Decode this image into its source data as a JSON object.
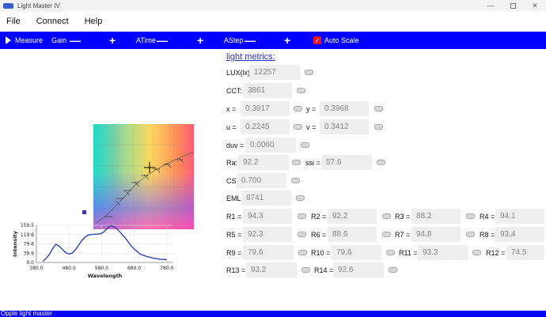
{
  "window": {
    "title": "Light Master IV",
    "minimize_label": "—",
    "close_label": "✕"
  },
  "menu": {
    "file": "File",
    "connect": "Connect",
    "help": "Help"
  },
  "toolbar": {
    "measure_label": "Measure",
    "gain_label": "Gain",
    "gain_minus": "—",
    "gain_plus": "+",
    "atime_label": "ATime",
    "atime_minus": "—",
    "atime_plus": "+",
    "astep_label": "AStep",
    "astep_minus": "—",
    "astep_plus": "+",
    "autoscale_label": "Auto Scale",
    "autoscale_checked": true,
    "checkbox_glyph": "✓"
  },
  "metrics": {
    "title": "light metrics:",
    "lux": {
      "label": "LUX(lx):",
      "value": "12257"
    },
    "cct": {
      "label": "CCT:",
      "value": "3861"
    },
    "x": {
      "label": "x =",
      "value": "0.3917"
    },
    "y": {
      "label": "y =",
      "value": "0.3968"
    },
    "u": {
      "label": "u =",
      "value": "0.2245"
    },
    "v": {
      "label": "v =",
      "value": "0.3412"
    },
    "duv": {
      "label": "duv =",
      "value": "0.0060"
    },
    "ra": {
      "label": "Ra:",
      "value": "92.2"
    },
    "ssi": {
      "label": "ssi =",
      "value": "57.6"
    },
    "cs": {
      "label": "CS:",
      "value": "0.700"
    },
    "eml": {
      "label": "EML:",
      "value": "8741"
    },
    "r": [
      {
        "label": "R1 =",
        "value": "94.3"
      },
      {
        "label": "R2 =",
        "value": "92.2"
      },
      {
        "label": "R3 =",
        "value": "88.2"
      },
      {
        "label": "R4 =",
        "value": "94.1"
      },
      {
        "label": "R5 =",
        "value": "92.3"
      },
      {
        "label": "R6 =",
        "value": "88.6"
      },
      {
        "label": "R7 =",
        "value": "94.8"
      },
      {
        "label": "R8 =",
        "value": "93.4"
      },
      {
        "label": "R9 =",
        "value": "79.6"
      },
      {
        "label": "R10 =",
        "value": "79.6"
      },
      {
        "label": "R11 =",
        "value": "93.3"
      },
      {
        "label": "R12 =",
        "value": "74.5"
      },
      {
        "label": "R13 =",
        "value": "93.2"
      },
      {
        "label": "R14 =",
        "value": "92.6"
      }
    ]
  },
  "status": {
    "text": "Opple light master"
  },
  "chart_data": {
    "type": "line",
    "xlabel": "Wavelength",
    "ylabel": "Intensity",
    "xticks": [
      "380.0",
      "480.0",
      "580.0",
      "680.0",
      "780.0"
    ],
    "yticks": [
      "0.0",
      "39.9",
      "79.8",
      "119.6",
      "159.5"
    ],
    "xlim": [
      380,
      800
    ],
    "ylim": [
      0,
      159.5
    ],
    "series_color": "#2a44b8",
    "x": [
      400,
      410,
      420,
      430,
      440,
      450,
      460,
      470,
      480,
      490,
      500,
      510,
      520,
      530,
      540,
      550,
      560,
      570,
      580,
      590,
      600,
      610,
      620,
      630,
      640,
      650,
      660,
      670,
      680,
      690,
      700,
      720,
      740,
      760,
      780
    ],
    "y": [
      5,
      18,
      35,
      60,
      78,
      70,
      55,
      42,
      36,
      40,
      55,
      75,
      95,
      110,
      118,
      120,
      121,
      122,
      125,
      135,
      150,
      158,
      152,
      140,
      125,
      110,
      92,
      72,
      58,
      45,
      35,
      25,
      18,
      14,
      12
    ]
  }
}
